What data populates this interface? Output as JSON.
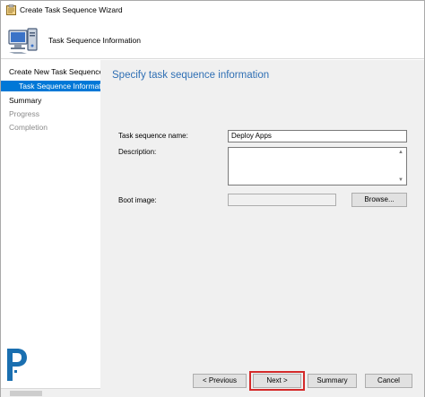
{
  "window": {
    "title": "Create Task Sequence Wizard"
  },
  "header": {
    "title": "Task Sequence Information"
  },
  "nav": {
    "items": [
      {
        "label": "Create New Task Sequence",
        "state": "active"
      },
      {
        "label": "Task Sequence Information",
        "state": "selected"
      },
      {
        "label": "Summary",
        "state": "active"
      },
      {
        "label": "Progress",
        "state": "disabled"
      },
      {
        "label": "Completion",
        "state": "disabled"
      }
    ]
  },
  "main": {
    "heading": "Specify task sequence information",
    "fields": {
      "name_label": "Task sequence name:",
      "name_value": "Deploy Apps",
      "description_label": "Description:",
      "description_value": "",
      "boot_image_label": "Boot image:",
      "boot_image_value": ""
    },
    "browse_label": "Browse..."
  },
  "footer": {
    "previous_label": "< Previous",
    "next_label": "Next >",
    "summary_label": "Summary",
    "cancel_label": "Cancel"
  },
  "colors": {
    "accent": "#0078d7",
    "heading": "#2f6fb4",
    "highlight": "#d42a2a"
  }
}
